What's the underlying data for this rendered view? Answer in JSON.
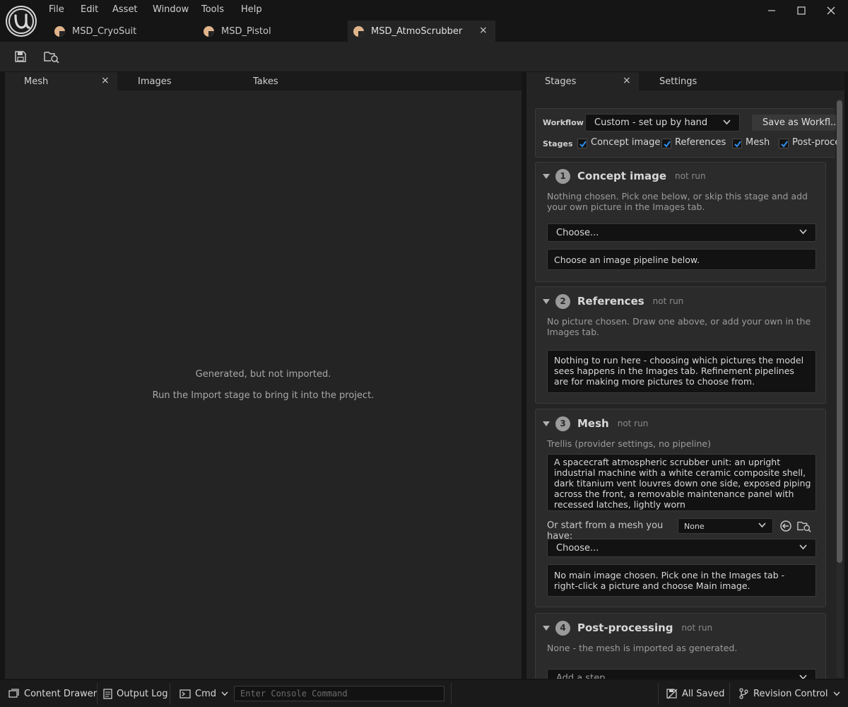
{
  "menu": [
    "File",
    "Edit",
    "Asset",
    "Window",
    "Tools",
    "Help"
  ],
  "doc_tabs": [
    {
      "label": "MSD_CryoSuit"
    },
    {
      "label": "MSD_Pistol"
    },
    {
      "label": "MSD_AtmoScrubber",
      "active": true
    }
  ],
  "left_panel": {
    "tabs": [
      "Mesh",
      "Images",
      "Takes"
    ],
    "message_line1": "Generated, but not imported.",
    "message_line2": "Run the Import stage to bring it into the project."
  },
  "right_panel": {
    "tabs": [
      "Stages",
      "Settings"
    ],
    "workflow": {
      "label": "Workflow",
      "value": "Custom - set up by hand",
      "save_button": "Save as Workfl...",
      "stages_label": "Stages",
      "checks": [
        "Concept image",
        "References",
        "Mesh",
        "Post-proce"
      ]
    },
    "stages": [
      {
        "num": "1",
        "title": "Concept image",
        "status": "not run",
        "hint": "Nothing chosen. Pick one below, or skip this stage and add your own picture in the Images tab.",
        "dropdown": "Choose...",
        "box": "Choose an image pipeline below."
      },
      {
        "num": "2",
        "title": "References",
        "status": "not run",
        "hint": "No picture chosen. Draw one above, or add your own in the Images tab.",
        "box": "Nothing to run here - choosing which pictures the model sees happens in the Images tab. Refinement pipelines are for making more pictures to choose from."
      },
      {
        "num": "3",
        "title": "Mesh",
        "status": "not run",
        "hint": "Trellis (provider settings, no pipeline)",
        "prompt": "A spacecraft atmospheric scrubber unit: an upright industrial machine with a white ceramic composite shell, dark titanium vent louvres down one side, exposed piping across the front, a removable maintenance panel with recessed latches, lightly worn",
        "mesh_label": "Or start from a mesh you have:",
        "mesh_value": "None",
        "dropdown": "Choose...",
        "box": "No main image chosen. Pick one in the Images tab - right-click a picture and choose Main image."
      },
      {
        "num": "4",
        "title": "Post-processing",
        "status": "not run",
        "hint": "None - the mesh is imported as generated.",
        "dropdown": "Add a step..."
      }
    ]
  },
  "statusbar": {
    "content_drawer": "Content Drawer",
    "output_log": "Output Log",
    "cmd": "Cmd",
    "console_placeholder": "Enter Console Command",
    "all_saved": "All Saved",
    "revision_control": "Revision Control"
  },
  "colors": {
    "accent": "#1a7fd8",
    "check": "#2b8ff0",
    "tab_icon": "#e0b48a"
  }
}
